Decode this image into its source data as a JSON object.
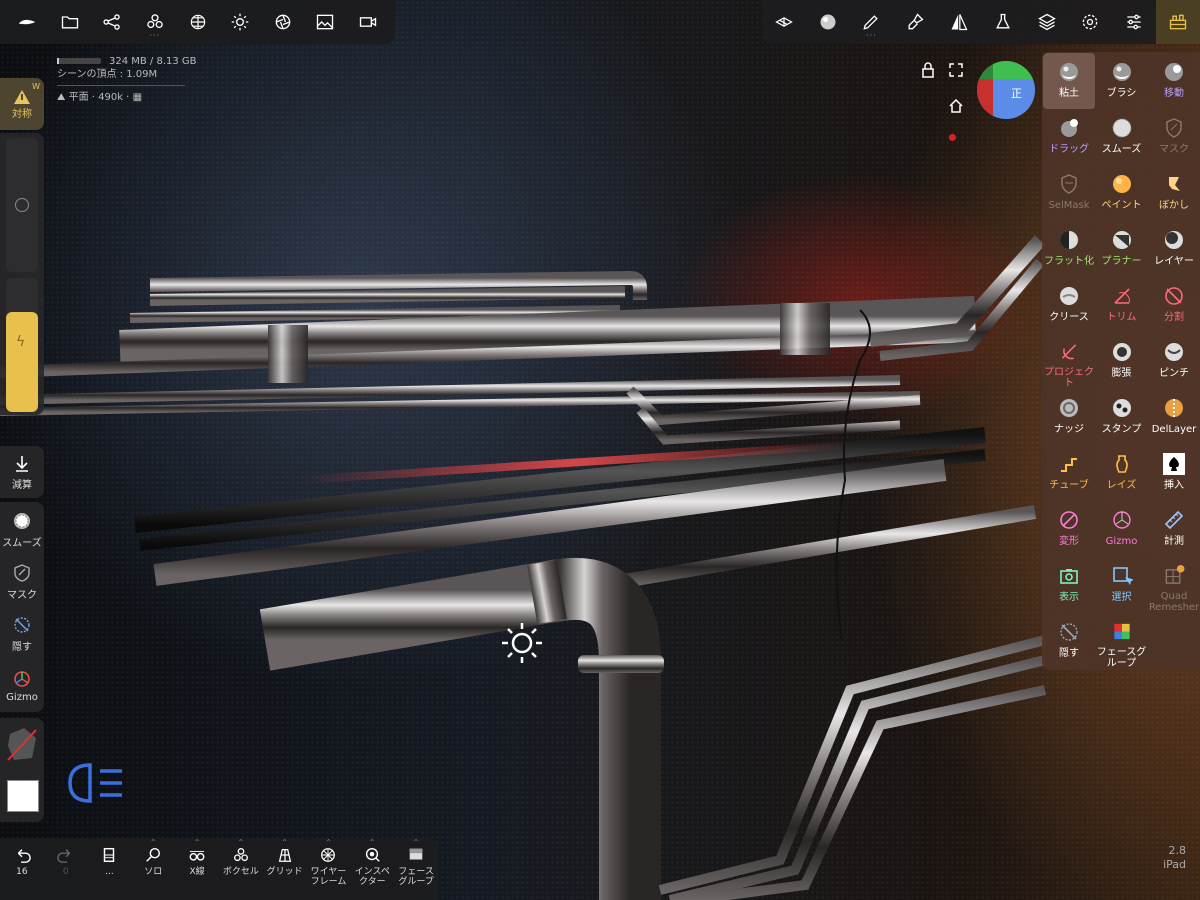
{
  "stats": {
    "memory": "324 MB / 8.13 GB",
    "vertices": "シーンの頂点 : 1.09M",
    "mesh": "平面 · 490k ·",
    "memory_fraction": 0.04
  },
  "left": {
    "symmetry": "対称",
    "symmetry_axis": "W",
    "radius_slider": 0.0,
    "intensity_slider": 0.4,
    "tools": [
      "減算",
      "スムーズ",
      "マスク",
      "隠す",
      "Gizmo"
    ]
  },
  "gizmo_label": "正",
  "topbar_right_active": "tools-button",
  "tools": [
    {
      "label": "粘土",
      "icon": "clay-icon",
      "color": "#ffffff",
      "active": true
    },
    {
      "label": "ブラシ",
      "icon": "brush-icon",
      "color": "#ffffff"
    },
    {
      "label": "移動",
      "icon": "move-icon",
      "color": "#b9a0ff"
    },
    {
      "label": "ドラッグ",
      "icon": "drag-icon",
      "color": "#b9a0ff"
    },
    {
      "label": "スムーズ",
      "icon": "smooth-icon",
      "color": "#ffffff"
    },
    {
      "label": "マスク",
      "icon": "mask-icon",
      "color": "#8a7a70"
    },
    {
      "label": "SelMask",
      "icon": "selmask-icon",
      "color": "#8a7a70"
    },
    {
      "label": "ペイント",
      "icon": "paint-icon",
      "color": "#ffd48a"
    },
    {
      "label": "ぼかし",
      "icon": "blur-icon",
      "color": "#ffd48a"
    },
    {
      "label": "フラット化",
      "icon": "flatten-icon",
      "color": "#9fe870"
    },
    {
      "label": "プラナー",
      "icon": "planar-icon",
      "color": "#9fe870"
    },
    {
      "label": "レイヤー",
      "icon": "layer-icon",
      "color": "#ffffff"
    },
    {
      "label": "クリース",
      "icon": "crease-icon",
      "color": "#ffffff"
    },
    {
      "label": "トリム",
      "icon": "trim-icon",
      "color": "#ff6a7a"
    },
    {
      "label": "分割",
      "icon": "split-icon",
      "color": "#ff6a7a"
    },
    {
      "label": "プロジェクト",
      "icon": "project-icon",
      "color": "#ff6a7a"
    },
    {
      "label": "膨張",
      "icon": "inflate-icon",
      "color": "#ffffff"
    },
    {
      "label": "ピンチ",
      "icon": "pinch-icon",
      "color": "#ffffff"
    },
    {
      "label": "ナッジ",
      "icon": "nudge-icon",
      "color": "#ffffff"
    },
    {
      "label": "スタンプ",
      "icon": "stamp-icon",
      "color": "#ffffff"
    },
    {
      "label": "DelLayer",
      "icon": "dellayer-icon",
      "color": "#ffffff"
    },
    {
      "label": "チューブ",
      "icon": "tube-icon",
      "color": "#ffbf47"
    },
    {
      "label": "レイズ",
      "icon": "lathe-icon",
      "color": "#ffbf47"
    },
    {
      "label": "挿入",
      "icon": "insert-icon",
      "color": "#ffffff"
    },
    {
      "label": "変形",
      "icon": "transform-icon",
      "color": "#ff7ad9"
    },
    {
      "label": "Gizmo",
      "icon": "gizmo-icon",
      "color": "#ff7ad9"
    },
    {
      "label": "計測",
      "icon": "measure-icon",
      "color": "#ffffff"
    },
    {
      "label": "表示",
      "icon": "view-icon",
      "color": "#7ef0c0"
    },
    {
      "label": "選択",
      "icon": "select-icon",
      "color": "#7ec8ff"
    },
    {
      "label": "Quad Remesher",
      "icon": "quadremesher-icon",
      "color": "#8a7a70"
    },
    {
      "label": "隠す",
      "icon": "hide-icon",
      "color": "#ffffff"
    },
    {
      "label": "フェースグループ",
      "icon": "facegroup-icon",
      "color": "#ffffff"
    }
  ],
  "bottom": [
    {
      "label": "16",
      "icon": "undo-icon"
    },
    {
      "label": "0",
      "icon": "redo-icon"
    },
    {
      "label": "...",
      "icon": "history-icon"
    },
    {
      "label": "ソロ",
      "icon": "solo-icon"
    },
    {
      "label": "X線",
      "icon": "xray-icon"
    },
    {
      "label": "ボクセル",
      "icon": "voxel-icon"
    },
    {
      "label": "グリッド",
      "icon": "grid-icon"
    },
    {
      "label": "ワイヤーフレーム",
      "icon": "wireframe-icon"
    },
    {
      "label": "インスペクター",
      "icon": "inspector-icon"
    },
    {
      "label": "フェースグループ",
      "icon": "facegroup-icon"
    }
  ],
  "version": "2.8",
  "device": "iPad",
  "colors": {
    "accent": "#e9c04d",
    "panel": "#4e3428"
  }
}
